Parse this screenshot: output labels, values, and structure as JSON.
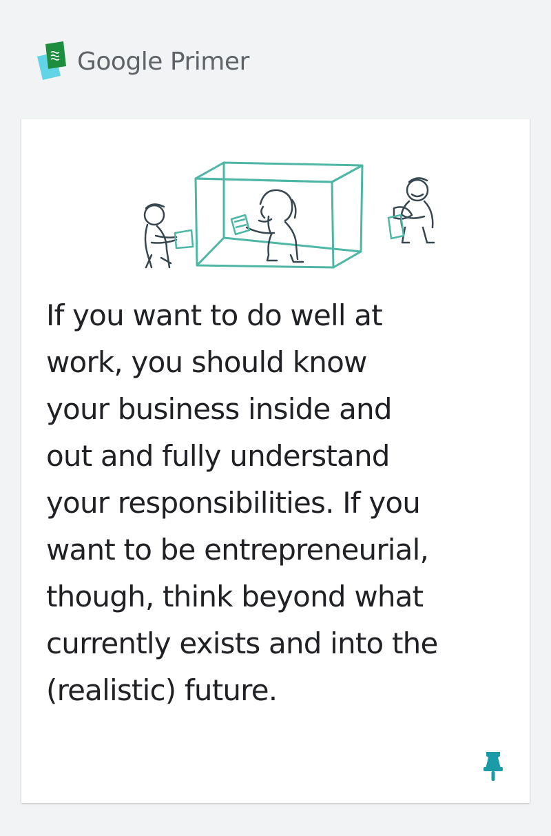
{
  "header": {
    "logo_icon": "primer-cards-icon",
    "brand_label": "Google Primer"
  },
  "card": {
    "illustration": "box-people-handing-cards-illustration",
    "body": "If you want to do well at\nwork, you should know\nyour business inside and\nout and fully understand\nyour responsibilities. If you\nwant to be entrepreneurial,\nthough, think beyond what\ncurrently exists and into the\n(realistic) future.",
    "pin_icon": "pin-icon"
  },
  "colors": {
    "background": "#f1f3f4",
    "card": "#ffffff",
    "text": "#202124",
    "brand_text": "#5f6368",
    "accent_teal": "#1b9aa8",
    "illustration_green": "#4db6a4"
  }
}
